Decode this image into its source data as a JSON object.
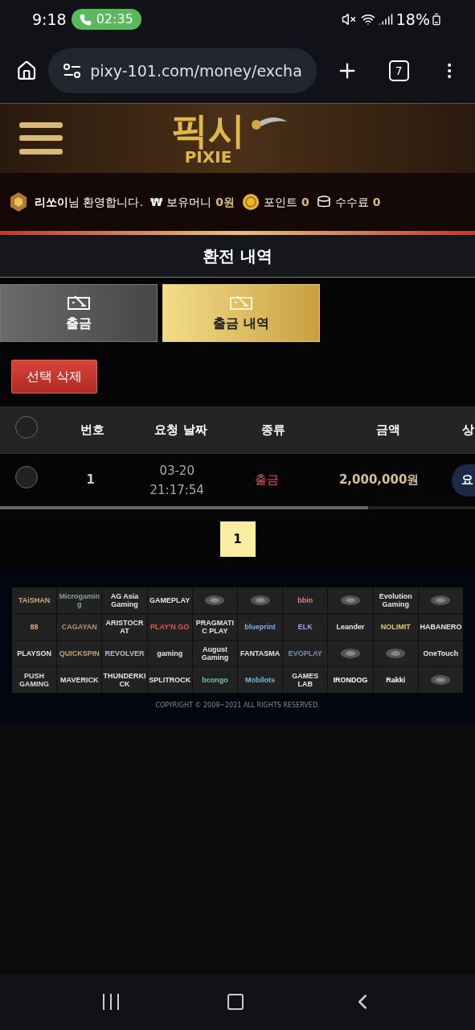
{
  "status_bar": {
    "time": "9:18",
    "call_timer": "02:35",
    "battery": "18%"
  },
  "browser": {
    "url": "pixy-101.com/money/excha",
    "tab_count": "7"
  },
  "logo": {
    "title": "픽시",
    "subtitle": "PIXIE"
  },
  "user_bar": {
    "name": "리쏘이",
    "greeting": "님 환영합니다.",
    "currency_symbol": "₩",
    "money_label": "보유머니",
    "money": "0원",
    "points_label": "포인트",
    "points": "0",
    "fee_label": "수수료",
    "fee": "0"
  },
  "page_title": "환전 내역",
  "tabs": [
    {
      "label": "출금",
      "selected": false
    },
    {
      "label": "출금 내역",
      "selected": true
    }
  ],
  "delete_button": "선택 삭제",
  "table": {
    "select_all_checked": false,
    "columns": [
      "번호",
      "요청 날짜",
      "종류",
      "금액",
      "상"
    ],
    "rows": [
      {
        "checked": false,
        "number": "1",
        "date": "03-20",
        "time": "21:17:54",
        "type": "출금",
        "amount": "2,000,000원",
        "status": "요"
      }
    ]
  },
  "pagination": [
    {
      "label": "1",
      "selected": true
    }
  ],
  "providers": [
    {
      "name": "TAiSHAN",
      "color": "#c9b27a"
    },
    {
      "name": "Microgaming",
      "color": "#7fa58a"
    },
    {
      "name": "AG Asia Gaming",
      "color": "#e6e6e6"
    },
    {
      "name": "GAMEPLAY",
      "color": "#e6e6e6"
    },
    {
      "kind": "mark"
    },
    {
      "kind": "mark"
    },
    {
      "name": "bbin",
      "color": "#c98a7a"
    },
    {
      "kind": "mark"
    },
    {
      "name": "Evolution Gaming",
      "color": "#e6e6e6"
    },
    {
      "kind": "mark"
    },
    {
      "name": "88",
      "color": "#d9a890"
    },
    {
      "name": "CAGAYAN",
      "color": "#a89a7a"
    },
    {
      "name": "ARISTOCRAT",
      "color": "#e6e6e6"
    },
    {
      "name": "PLAY'N GO",
      "color": "#e05a4a"
    },
    {
      "name": "PRAGMATIC PLAY",
      "color": "#e6e6e6"
    },
    {
      "name": "blueprint",
      "color": "#7ab0e6"
    },
    {
      "name": "ELK",
      "color": "#8fb0e6"
    },
    {
      "name": "Leander",
      "color": "#e6e6e6"
    },
    {
      "name": "NOLIMIT",
      "color": "#d9cc7a"
    },
    {
      "name": "HABANERO",
      "color": "#e6e6e6"
    },
    {
      "name": "PLAYSON",
      "color": "#e6e6e6"
    },
    {
      "name": "QUICKSPIN",
      "color": "#c9a070"
    },
    {
      "name": "REVOLVER",
      "color": "#bdbdbd"
    },
    {
      "name": "gaming",
      "color": "#e6e6e6"
    },
    {
      "name": "August Gaming",
      "color": "#e6e6e6"
    },
    {
      "name": "FANTASMA",
      "color": "#e6e6e6"
    },
    {
      "name": "EVOPLAY",
      "color": "#7a8fb0"
    },
    {
      "kind": "mark"
    },
    {
      "kind": "mark"
    },
    {
      "name": "OneTouch",
      "color": "#e6e6e6"
    },
    {
      "name": "PUSH GAMING",
      "color": "#d9d9d9"
    },
    {
      "name": "MAVERICK",
      "color": "#e6e6e6"
    },
    {
      "name": "THUNDERKICK",
      "color": "#e6e6e6"
    },
    {
      "name": "SPLITROCK",
      "color": "#e6e6e6"
    },
    {
      "name": "bcongo",
      "color": "#7ac0a0"
    },
    {
      "name": "Mobilots",
      "color": "#7ab8d0"
    },
    {
      "name": "GAMES LAB",
      "color": "#e6e6e6"
    },
    {
      "name": "IRONDOG",
      "color": "#ffffff"
    },
    {
      "name": "Rakki",
      "color": "#ffffff"
    },
    {
      "kind": "mark"
    }
  ],
  "copyright": "COPYRIGHT © 2009~2021 ALL RIGHTS RESERVED."
}
